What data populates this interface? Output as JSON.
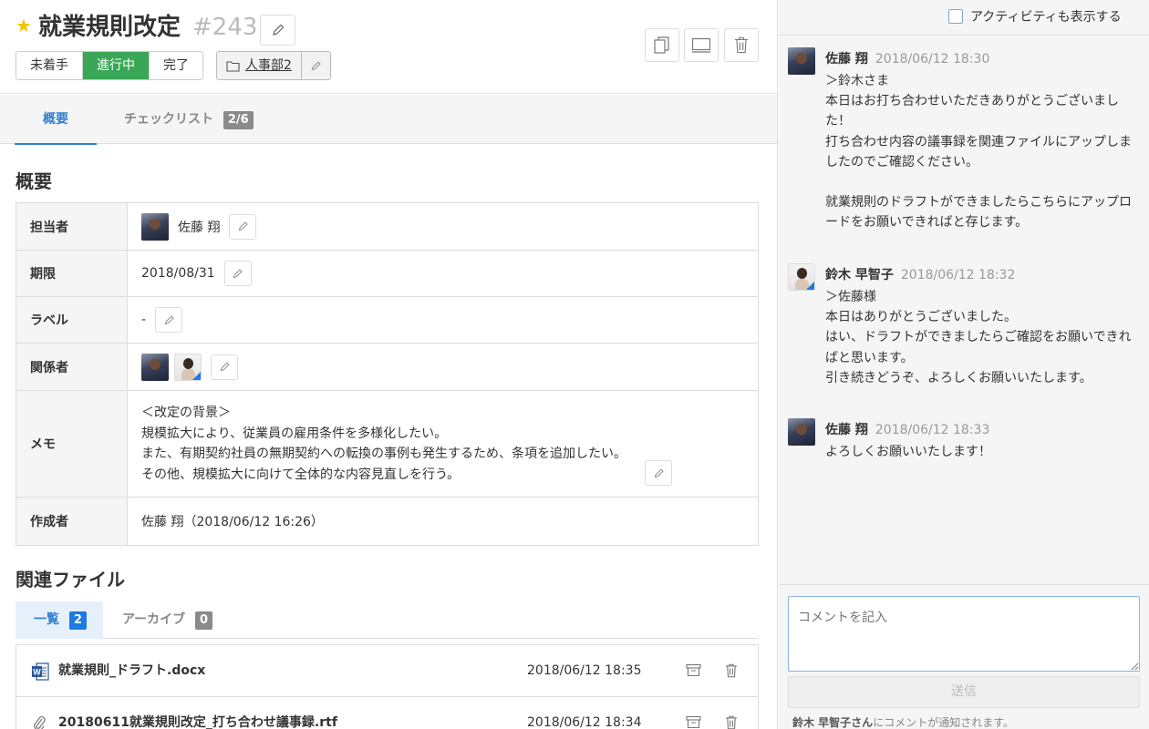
{
  "task": {
    "title": "就業規則改定",
    "number": "#243",
    "statuses": [
      "未着手",
      "進行中",
      "完了"
    ],
    "active_status": "進行中",
    "folder": "人事部2"
  },
  "tabs": {
    "summary": "概要",
    "checklist": "チェックリスト",
    "checklist_count": "2/6"
  },
  "summary": {
    "title": "概要",
    "assignee_label": "担当者",
    "assignee_name": "佐藤 翔",
    "due_label": "期限",
    "due_value": "2018/08/31",
    "label_label": "ラベル",
    "label_value": "-",
    "members_label": "関係者",
    "memo_label": "メモ",
    "memo_lines": [
      "＜改定の背景＞",
      "規模拡大により、従業員の雇用条件を多様化したい。",
      "また、有期契約社員の無期契約への転換の事例も発生するため、条項を追加したい。",
      "その他、規模拡大に向けて全体的な内容見直しを行う。"
    ],
    "creator_label": "作成者",
    "creator_value": "佐藤 翔（2018/06/12 16:26）"
  },
  "files": {
    "title": "関連ファイル",
    "tab_list": "一覧",
    "tab_list_count": "2",
    "tab_archive": "アーカイブ",
    "tab_archive_count": "0",
    "items": [
      {
        "name": "就業規則_ドラフト.docx",
        "date": "2018/06/12 18:35",
        "icon": "word-doc-icon"
      },
      {
        "name": "20180611就業規則改定_打ち合わせ議事録.rtf",
        "date": "2018/06/12 18:34",
        "icon": "paperclip-icon"
      }
    ]
  },
  "activity": {
    "toggle_label": "アクティビティも表示する"
  },
  "comments": [
    {
      "author": "佐藤 翔",
      "date": "2018/06/12 18:30",
      "avatar": "sato",
      "body": "＞鈴木さま\n本日はお打ち合わせいただきありがとうございまし\nた！\n打ち合わせ内容の議事録を関連ファイルにアップしま\nしたのでご確認ください。\n\n就業規則のドラフトができましたらこちらにアップロ\nードをお願いできればと存じます。"
    },
    {
      "author": "鈴木 早智子",
      "date": "2018/06/12 18:32",
      "avatar": "suzuki",
      "body": "＞佐藤様\n本日はありがとうございました。\nはい、ドラフトができましたらご確認をお願いできれ\nばと思います。\n引き続きどうぞ、よろしくお願いいたします。"
    },
    {
      "author": "佐藤 翔",
      "date": "2018/06/12 18:33",
      "avatar": "sato",
      "body": "よろしくお願いいたします！"
    }
  ],
  "composer": {
    "placeholder": "コメントを記入",
    "send_label": "送信",
    "notify_name": "鈴木 早智子さん",
    "notify_suffix": "にコメントが通知されます。"
  }
}
